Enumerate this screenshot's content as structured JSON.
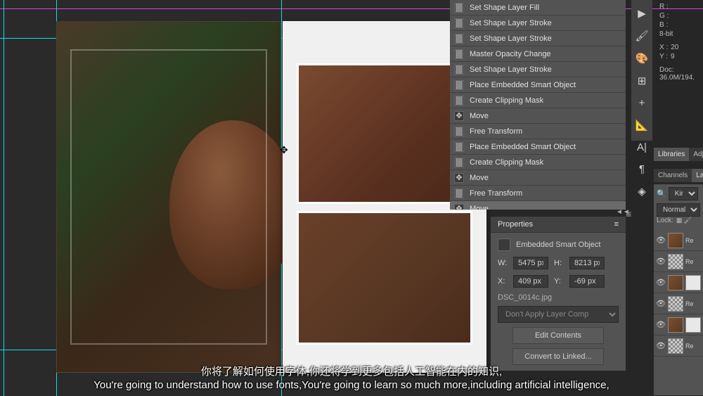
{
  "history": {
    "items": [
      {
        "icon": "doc",
        "label": "Set Shape Layer Fill"
      },
      {
        "icon": "doc",
        "label": "Set Shape Layer Stroke"
      },
      {
        "icon": "doc",
        "label": "Set Shape Layer Stroke"
      },
      {
        "icon": "doc",
        "label": "Master Opacity Change"
      },
      {
        "icon": "doc",
        "label": "Set Shape Layer Stroke"
      },
      {
        "icon": "doc",
        "label": "Place Embedded Smart Object"
      },
      {
        "icon": "doc",
        "label": "Create Clipping Mask"
      },
      {
        "icon": "move",
        "label": "Move"
      },
      {
        "icon": "doc",
        "label": "Free Transform"
      },
      {
        "icon": "doc",
        "label": "Place Embedded Smart Object"
      },
      {
        "icon": "doc",
        "label": "Create Clipping Mask"
      },
      {
        "icon": "move",
        "label": "Move"
      },
      {
        "icon": "doc",
        "label": "Free Transform"
      },
      {
        "icon": "move",
        "label": "Move"
      }
    ]
  },
  "properties": {
    "title": "Properties",
    "type": "Embedded Smart Object",
    "w_label": "W:",
    "w_value": "5475 px",
    "h_label": "H:",
    "h_value": "8213 px",
    "x_label": "X:",
    "x_value": "409 px",
    "y_label": "Y:",
    "y_value": "-69 px",
    "filename": "DSC_0014c.jpg",
    "layer_comp_placeholder": "Don't Apply Layer Comp",
    "edit_contents": "Edit Contents",
    "convert_linked": "Convert to Linked..."
  },
  "info": {
    "r": "R :",
    "g": "G :",
    "b": "B :",
    "bits": "8-bit",
    "x": "X :",
    "x_val": "20",
    "y": "Y :",
    "y_val": "9",
    "doc": "Doc: 36.0M/194."
  },
  "panel_tabs": {
    "libraries": "Libraries",
    "adjustments": "Adj",
    "channels": "Channels",
    "layers": "Lay"
  },
  "layers": {
    "kind_label": "Kind",
    "blend_mode": "Normal",
    "lock_label": "Lock:",
    "items": [
      {
        "thumb": "photo",
        "name": "Re"
      },
      {
        "thumb": "checker",
        "name": "Re"
      },
      {
        "thumb": "photo",
        "name": "Re"
      },
      {
        "thumb": "checker",
        "name": "Re"
      },
      {
        "thumb": "photo",
        "name": "Re"
      },
      {
        "thumb": "checker",
        "name": "Re"
      }
    ]
  },
  "subtitles": {
    "cn": "你将了解如何使用字体,你还将学到更多包括人工智能在内的知识,",
    "en": "You're going to understand how to use fonts,You're going to learn so much more,including artificial intelligence,"
  }
}
